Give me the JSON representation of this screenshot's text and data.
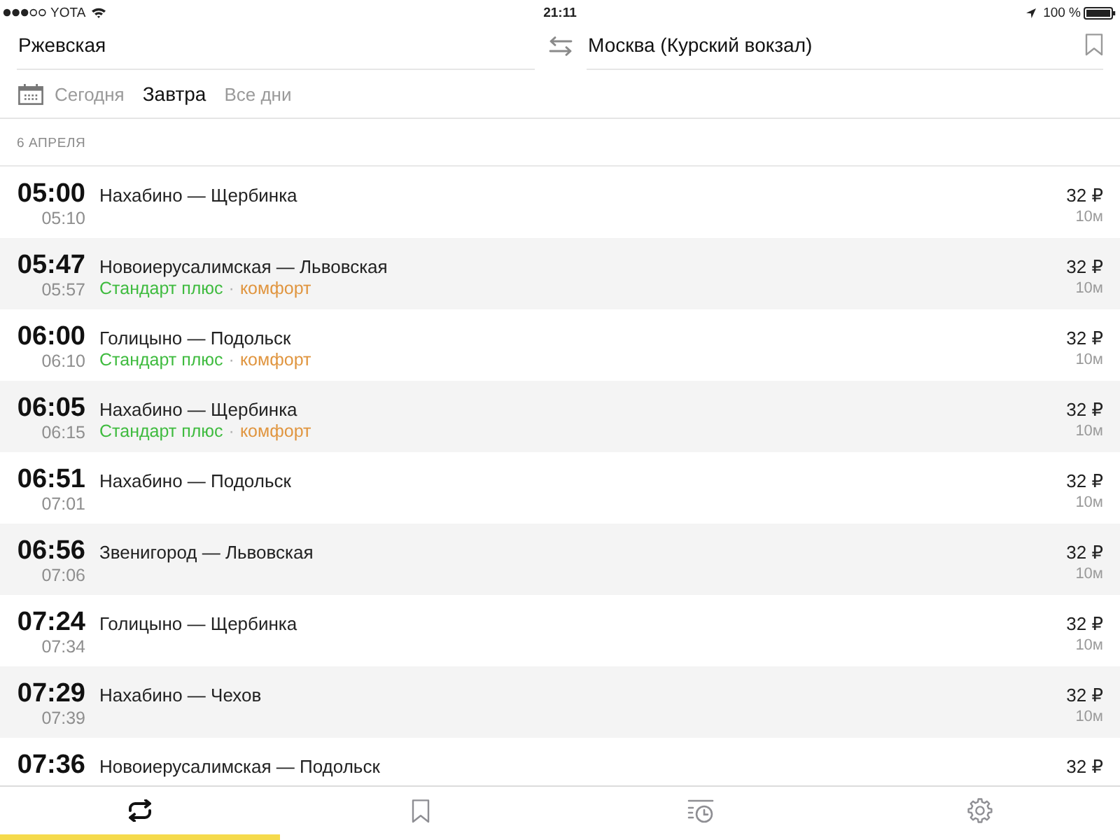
{
  "status_bar": {
    "carrier": "YOTA",
    "time": "21:11",
    "battery": "100 %"
  },
  "route": {
    "from": "Ржевская",
    "to": "Москва (Курский вокзал)"
  },
  "days": [
    {
      "label": "Сегодня",
      "selected": false
    },
    {
      "label": "Завтра",
      "selected": true
    },
    {
      "label": "Все дни",
      "selected": false
    }
  ],
  "section_title": "6 АПРЕЛЯ",
  "trains": [
    {
      "departure": "05:00",
      "arrival": "05:10",
      "route": "Нахабино — Щербинка",
      "price": "32 ₽",
      "duration": "10м"
    },
    {
      "departure": "05:47",
      "arrival": "05:57",
      "route": "Новоиерусалимская — Львовская",
      "tags": [
        {
          "label": "Стандарт плюс",
          "color": "#3fbb3f"
        },
        {
          "label": "комфорт",
          "color": "#e0953f"
        }
      ],
      "tag_separator": "·",
      "price": "32 ₽",
      "duration": "10м"
    },
    {
      "departure": "06:00",
      "arrival": "06:10",
      "route": "Голицыно — Подольск",
      "tags": [
        {
          "label": "Стандарт плюс",
          "color": "#3fbb3f"
        },
        {
          "label": "комфорт",
          "color": "#e0953f"
        }
      ],
      "tag_separator": "·",
      "price": "32 ₽",
      "duration": "10м"
    },
    {
      "departure": "06:05",
      "arrival": "06:15",
      "route": "Нахабино — Щербинка",
      "tags": [
        {
          "label": "Стандарт плюс",
          "color": "#3fbb3f"
        },
        {
          "label": "комфорт",
          "color": "#e0953f"
        }
      ],
      "tag_separator": "·",
      "price": "32 ₽",
      "duration": "10м"
    },
    {
      "departure": "06:51",
      "arrival": "07:01",
      "route": "Нахабино — Подольск",
      "price": "32 ₽",
      "duration": "10м"
    },
    {
      "departure": "06:56",
      "arrival": "07:06",
      "route": "Звенигород — Львовская",
      "price": "32 ₽",
      "duration": "10м"
    },
    {
      "departure": "07:24",
      "arrival": "07:34",
      "route": "Голицыно — Щербинка",
      "price": "32 ₽",
      "duration": "10м"
    },
    {
      "departure": "07:29",
      "arrival": "07:39",
      "route": "Нахабино — Чехов",
      "price": "32 ₽",
      "duration": "10м"
    },
    {
      "departure": "07:36",
      "route": "Новоиерусалимская — Подольск",
      "price": "32 ₽"
    }
  ],
  "tabs": [
    {
      "kind": "routes",
      "selected": true
    },
    {
      "kind": "favorites",
      "selected": false
    },
    {
      "kind": "history",
      "selected": false
    },
    {
      "kind": "settings",
      "selected": false
    }
  ]
}
